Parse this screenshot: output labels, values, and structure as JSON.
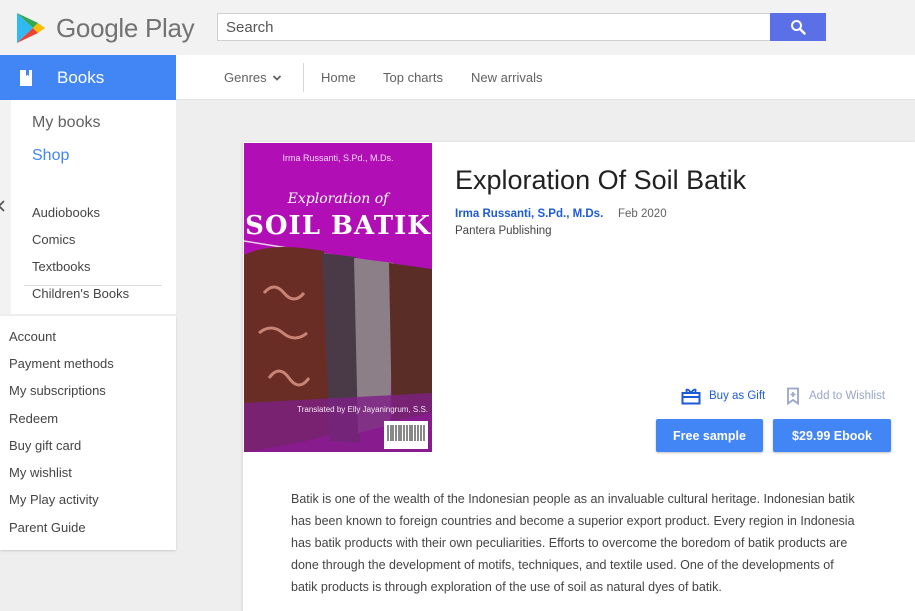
{
  "header": {
    "brand": "Google Play",
    "search_placeholder": "Search"
  },
  "nav": {
    "section_label": "Books",
    "genres_label": "Genres",
    "home_label": "Home",
    "top_charts_label": "Top charts",
    "new_arrivals_label": "New arrivals"
  },
  "sidebar": {
    "my_books": "My books",
    "shop": "Shop",
    "categories": [
      "Audiobooks",
      "Comics",
      "Textbooks",
      "Children's Books"
    ],
    "account_links": [
      "Account",
      "Payment methods",
      "My subscriptions",
      "Redeem",
      "Buy gift card",
      "My wishlist",
      "My Play activity",
      "Parent Guide"
    ]
  },
  "book": {
    "title": "Exploration Of Soil Batik",
    "author": "Irma Russanti, S.Pd., M.Ds.",
    "date": "Feb 2020",
    "publisher": "Pantera Publishing",
    "buy_as_gift": "Buy as Gift",
    "add_to_wishlist": "Add to Wishlist",
    "free_sample": "Free sample",
    "price_ebook": "$29.99 Ebook",
    "description": [
      "Batik is one of the wealth of the Indonesian people as an invaluable cultural heritage. Indonesian batik",
      "has been known to foreign countries and become a superior export product. Every region in Indonesia",
      "has batik products with their own peculiarities. Efforts to overcome the boredom of batik products are",
      "done through the development of motifs, techniques, and textile used. One of the developments of",
      "batik products is through exploration of the use of soil as natural dyes of batik."
    ],
    "cover": {
      "author_line": "Irma Russanti, S.Pd., M.Ds.",
      "title_line1": "Exploration of",
      "title_line2": "SOIL BATIK",
      "translator": "Translated by Elly Jayaningrum, S.S.",
      "background": "#b10fb5"
    }
  },
  "colors": {
    "accent": "#4285f4",
    "search_button": "#5b6fe7",
    "link": "#1e5bd6"
  }
}
